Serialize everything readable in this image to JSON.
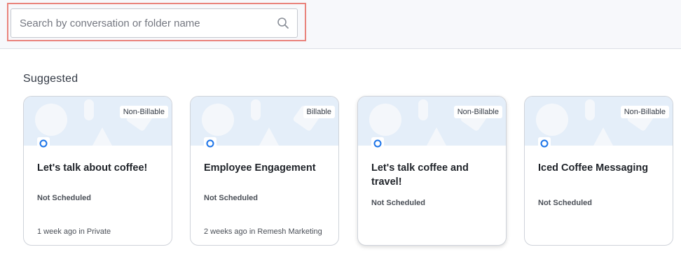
{
  "search": {
    "placeholder": "Search by conversation or folder name",
    "value": ""
  },
  "section_title": "Suggested",
  "cards": [
    {
      "billing": "Non-Billable",
      "title": "Let's talk about coffee!",
      "status": "Not Scheduled",
      "meta": "1 week ago in Private"
    },
    {
      "billing": "Billable",
      "title": "Employee Engagement",
      "status": "Not Scheduled",
      "meta": "2 weeks ago in Remesh Marketing"
    },
    {
      "billing": "Non-Billable",
      "title": "Let's talk coffee and travel!",
      "status": "Not Scheduled",
      "meta": ""
    },
    {
      "billing": "Non-Billable",
      "title": "Iced Coffee Messaging",
      "status": "Not Scheduled",
      "meta": ""
    }
  ],
  "colors": {
    "accent": "#1a73e8",
    "highlight": "#e9837c",
    "banner": "#e4eef9"
  },
  "icons": {
    "search": "search-icon",
    "card_type": "circle-icon"
  }
}
